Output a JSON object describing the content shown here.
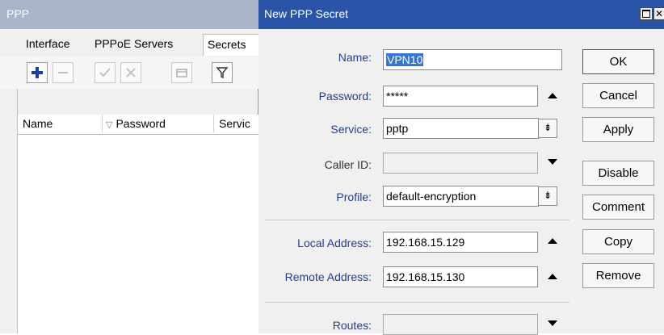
{
  "ppp_window": {
    "title": "PPP",
    "tabs": [
      "Interface",
      "PPPoE Servers",
      "Secrets"
    ],
    "active_tab": "Secrets",
    "table_columns": [
      "Name",
      "Password",
      "Servic"
    ]
  },
  "dialog": {
    "title": "New PPP Secret",
    "fields": {
      "name": {
        "label": "Name:",
        "value": "VPN10"
      },
      "password": {
        "label": "Password:",
        "value": "*****"
      },
      "service": {
        "label": "Service:",
        "value": "pptp"
      },
      "caller_id": {
        "label": "Caller ID:",
        "value": ""
      },
      "profile": {
        "label": "Profile:",
        "value": "default-encryption"
      },
      "local_address": {
        "label": "Local Address:",
        "value": "192.168.15.129"
      },
      "remote_address": {
        "label": "Remote Address:",
        "value": "192.168.15.130"
      },
      "routes": {
        "label": "Routes:",
        "value": ""
      }
    },
    "buttons": {
      "ok": "OK",
      "cancel": "Cancel",
      "apply": "Apply",
      "disable": "Disable",
      "comment": "Comment",
      "copy": "Copy",
      "remove": "Remove"
    }
  },
  "colors": {
    "dialog_titlebar": "#2a54a8",
    "ppp_titlebar": "#a9b5c9",
    "label_blue": "#1f3f8f",
    "selection": "#3478d4"
  },
  "icons": [
    "plus-icon",
    "minus-icon",
    "check-icon",
    "cross-icon",
    "note-icon",
    "filter-icon",
    "sort-icon",
    "maximize-icon",
    "close-icon"
  ]
}
